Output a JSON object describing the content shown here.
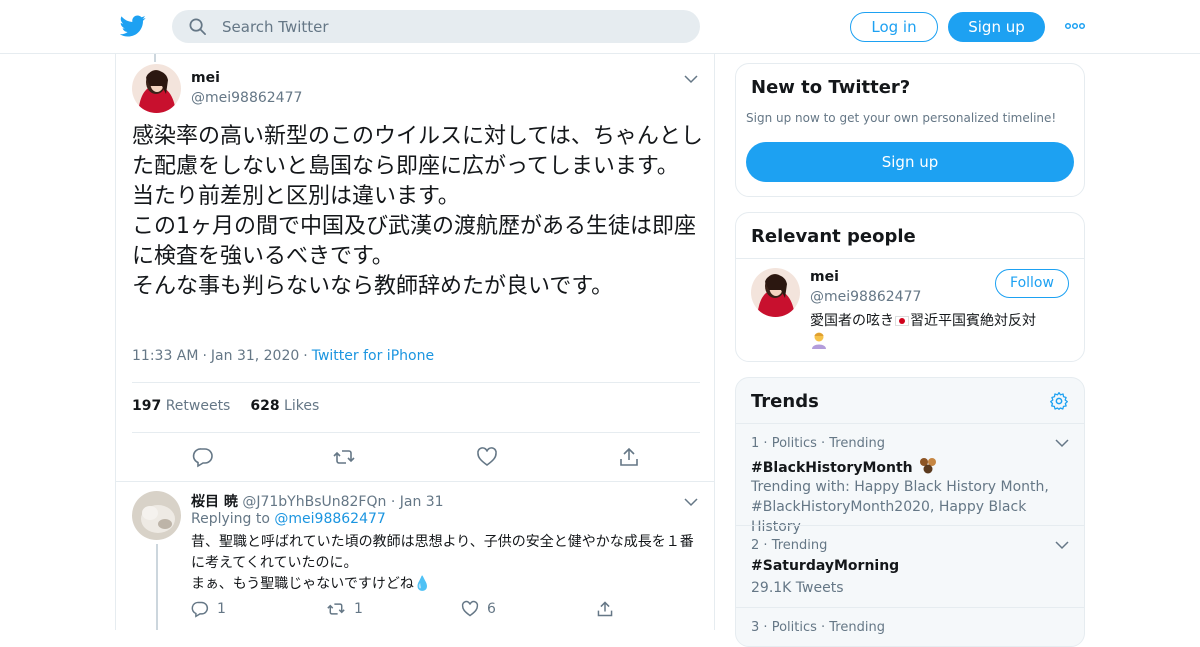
{
  "header": {
    "search_placeholder": "Search Twitter",
    "login_label": "Log in",
    "signup_label": "Sign up"
  },
  "tweet": {
    "name": "mei",
    "handle": "@mei98862477",
    "text": "感染率の高い新型のこのウイルスに対しては、ちゃんとした配慮をしないと島国なら即座に広がってしまいます。\n当たり前差別と区別は違います。\nこの1ヶ月の間で中国及び武漢の渡航歴がある生徒は即座に検査を強いるべきです。\nそんな事も判らないなら教師辞めたが良いです。",
    "time": "11:33 AM",
    "date": "Jan 31, 2020",
    "source": "Twitter for iPhone",
    "retweets_count": "197",
    "retweets_label": "Retweets",
    "likes_count": "628",
    "likes_label": "Likes"
  },
  "reply": {
    "name": "桜目 暁",
    "handle": "@J71bYhBsUn82FQn",
    "date": "Jan 31",
    "replying_to_label": "Replying to",
    "replying_to_handle": "@mei98862477",
    "text": "昔、聖職と呼ばれていた頃の教師は思想より、子供の安全と健やかな成長を１番に考えてくれていたのに。\nまぁ、もう聖職じゃないですけどね💧",
    "reply_count": "1",
    "retweet_count": "1",
    "like_count": "6"
  },
  "sidebar": {
    "new_to_twitter": {
      "title": "New to Twitter?",
      "subtitle": "Sign up now to get your own personalized timeline!",
      "button": "Sign up"
    },
    "relevant_people": {
      "title": "Relevant people",
      "name": "mei",
      "handle": "@mei98862477",
      "follow_label": "Follow",
      "bio_before_flag": "愛国者の呟き",
      "bio_after_flag": "習近平国賓絶対反対"
    },
    "trends": {
      "title": "Trends",
      "items": [
        {
          "rank": "1",
          "context": "Politics · Trending",
          "name": "#BlackHistoryMonth",
          "desc": "Trending with: Happy Black History Month, #BlackHistoryMonth2020, Happy Black History"
        },
        {
          "rank": "2",
          "context": "Trending",
          "name": "#SaturdayMorning",
          "desc": "29.1K Tweets"
        },
        {
          "rank": "3",
          "context": "Politics · Trending",
          "name": "",
          "desc": ""
        }
      ]
    }
  },
  "colors": {
    "accent": "#1da1f2",
    "link": "#1b95e0",
    "muted": "#657786",
    "border": "#e6ecf0"
  }
}
